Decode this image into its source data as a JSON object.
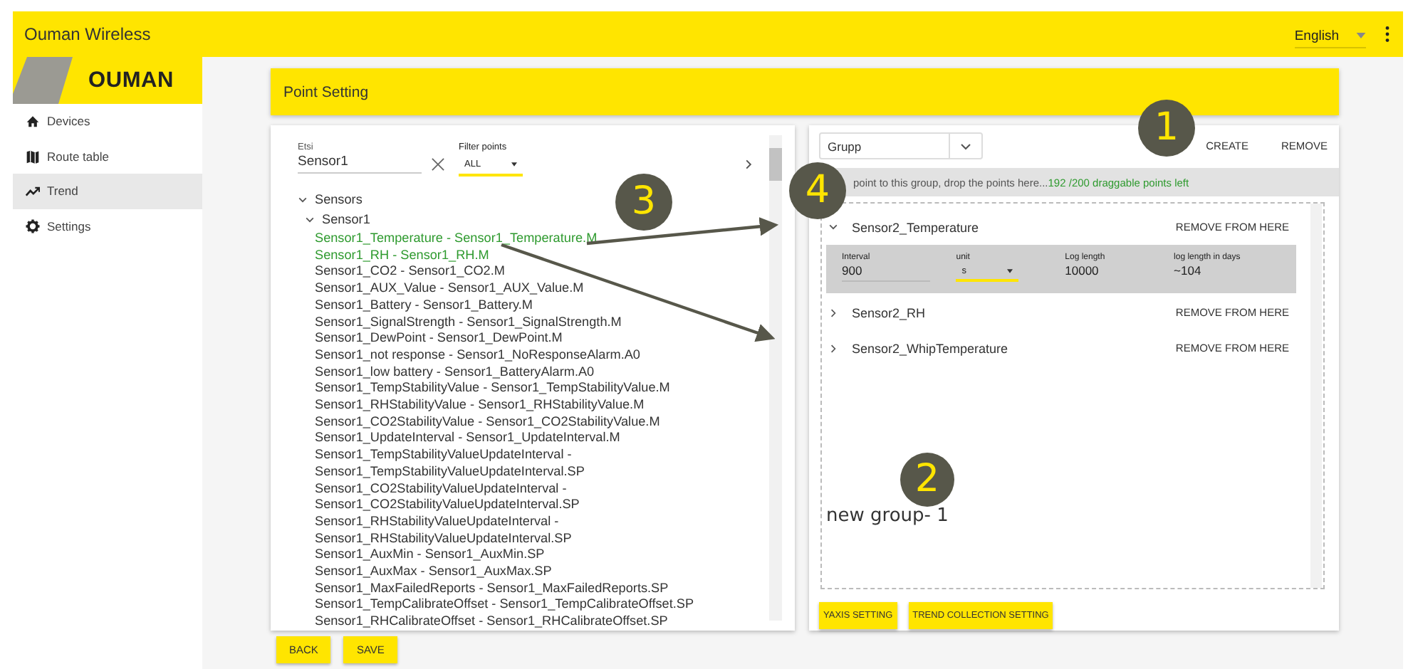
{
  "app": {
    "title": "Ouman Wireless",
    "language": "English"
  },
  "sidebar": {
    "logo": "OUMAN",
    "items": [
      {
        "label": "Devices",
        "kind": "home",
        "selected": false
      },
      {
        "label": "Route table",
        "kind": "map",
        "selected": false
      },
      {
        "label": "Trend",
        "kind": "trend",
        "selected": true
      },
      {
        "label": "Settings",
        "kind": "gear",
        "selected": false
      }
    ]
  },
  "page": {
    "title": "Point Setting"
  },
  "points_panel": {
    "search": {
      "label": "Etsi",
      "value": "Sensor1"
    },
    "filter": {
      "label": "Filter points",
      "value": "ALL"
    },
    "tree": [
      {
        "label": "Sensors",
        "expanded": true,
        "children": [
          {
            "label": "Sensor1",
            "expanded": true,
            "children": [
              {
                "label": "Sensor1_Temperature - Sensor1_Temperature.M",
                "selected": true
              },
              {
                "label": "Sensor1_RH - Sensor1_RH.M",
                "selected": true
              },
              {
                "label": "Sensor1_CO2 - Sensor1_CO2.M",
                "selected": false
              },
              {
                "label": "Sensor1_AUX_Value - Sensor1_AUX_Value.M",
                "selected": false
              },
              {
                "label": "Sensor1_Battery - Sensor1_Battery.M",
                "selected": false
              },
              {
                "label": "Sensor1_SignalStrength - Sensor1_SignalStrength.M",
                "selected": false
              },
              {
                "label": "Sensor1_DewPoint - Sensor1_DewPoint.M",
                "selected": false
              },
              {
                "label": "Sensor1_not response - Sensor1_NoResponseAlarm.A0",
                "selected": false
              },
              {
                "label": "Sensor1_low battery - Sensor1_BatteryAlarm.A0",
                "selected": false
              },
              {
                "label": "Sensor1_TempStabilityValue - Sensor1_TempStabilityValue.M",
                "selected": false
              },
              {
                "label": "Sensor1_RHStabilityValue - Sensor1_RHStabilityValue.M",
                "selected": false
              },
              {
                "label": "Sensor1_CO2StabilityValue - Sensor1_CO2StabilityValue.M",
                "selected": false
              },
              {
                "label": "Sensor1_UpdateInterval - Sensor1_UpdateInterval.M",
                "selected": false
              },
              {
                "label": "Sensor1_TempStabilityValueUpdateInterval - Sensor1_TempStabilityValueUpdateInterval.SP",
                "selected": false
              },
              {
                "label": "Sensor1_CO2StabilityValueUpdateInterval - Sensor1_CO2StabilityValueUpdateInterval.SP",
                "selected": false
              },
              {
                "label": "Sensor1_RHStabilityValueUpdateInterval - Sensor1_RHStabilityValueUpdateInterval.SP",
                "selected": false
              },
              {
                "label": "Sensor1_AuxMin - Sensor1_AuxMin.SP",
                "selected": false
              },
              {
                "label": "Sensor1_AuxMax - Sensor1_AuxMax.SP",
                "selected": false
              },
              {
                "label": "Sensor1_MaxFailedReports - Sensor1_MaxFailedReports.SP",
                "selected": false
              },
              {
                "label": "Sensor1_TempCalibrateOffset - Sensor1_TempCalibrateOffset.SP",
                "selected": false
              },
              {
                "label": "Sensor1_RHCalibrateOffset - Sensor1_RHCalibrateOffset.SP",
                "selected": false
              }
            ]
          }
        ]
      }
    ]
  },
  "group_panel": {
    "group_select": "Grupp",
    "buttons": [
      "CREATE",
      "REMOVE"
    ],
    "hint": "point to this group, drop the points here...",
    "points_left": "192 /200 draggable points left",
    "items": [
      {
        "name": "Sensor2_Temperature",
        "expanded": true,
        "action": "REMOVE FROM HERE",
        "details": [
          {
            "label": "Interval",
            "value": "900",
            "kind": "text"
          },
          {
            "label": "unit",
            "value": "s",
            "kind": "select"
          },
          {
            "label": "Log length",
            "value": "10000",
            "kind": "plain"
          },
          {
            "label": "log length in days",
            "value": "~104",
            "kind": "plain"
          }
        ]
      },
      {
        "name": "Sensor2_RH",
        "expanded": false,
        "action": "REMOVE FROM HERE"
      },
      {
        "name": "Sensor2_WhipTemperature",
        "expanded": false,
        "action": "REMOVE FROM HERE"
      }
    ],
    "new_group": "new group- 1",
    "buttons_bottom": [
      "YAXIS SETTING",
      "TREND COLLECTION SETTING"
    ]
  },
  "footer_buttons": [
    "BACK",
    "SAVE"
  ],
  "annotations": [
    {
      "number": "1"
    },
    {
      "number": "2"
    },
    {
      "number": "3"
    },
    {
      "number": "4"
    }
  ]
}
